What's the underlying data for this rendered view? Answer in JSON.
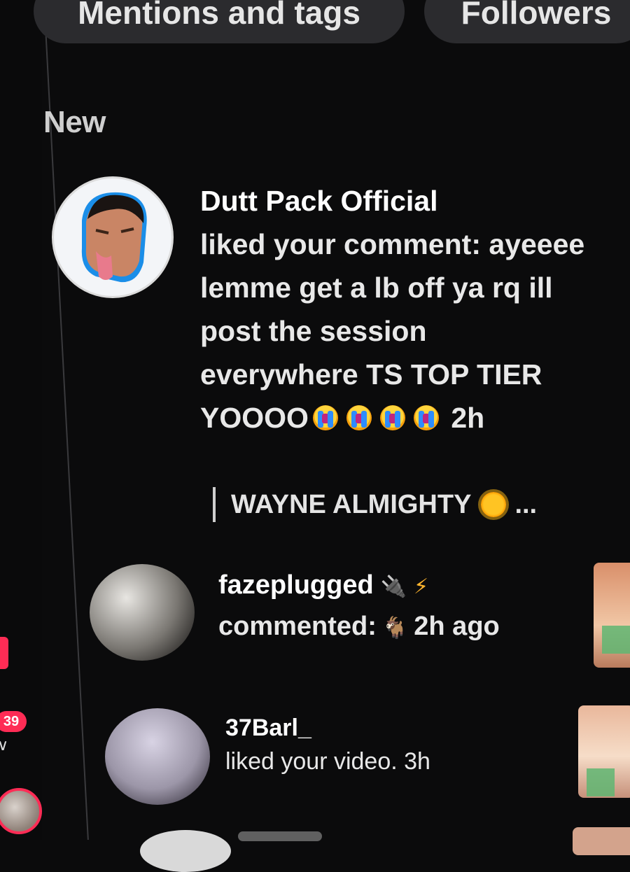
{
  "filters": [
    {
      "label": "Mentions and tags"
    },
    {
      "label": "Followers"
    }
  ],
  "section_title": "New",
  "rail": {
    "badge_count": "39",
    "chevron": "∨"
  },
  "notifications": [
    {
      "user": "Dutt Pack Official",
      "action": "liked your comment:",
      "comment": "ayeeee lemme get a lb off ya rq ill post the session everywhere TS TOP TIER YOOOO",
      "emoji": "loudly-crying-face",
      "emoji_count": 4,
      "time": "2h",
      "reply_to": "WAYNE ALMIGHTY",
      "reply_emoji": "sun-icon",
      "ellipsis": "..."
    },
    {
      "user": "fazeplugged",
      "user_icons": [
        "plug-icon",
        "lightning-icon"
      ],
      "action": "commented:",
      "comment_emoji": "goat-icon",
      "time": "2h ago"
    },
    {
      "user": "37Barl_",
      "action": "liked your video.",
      "time": "3h"
    }
  ],
  "colors": {
    "background": "#0b0b0c",
    "pill": "#2b2b2e",
    "badge": "#fe2c55",
    "text": "#ffffff"
  }
}
